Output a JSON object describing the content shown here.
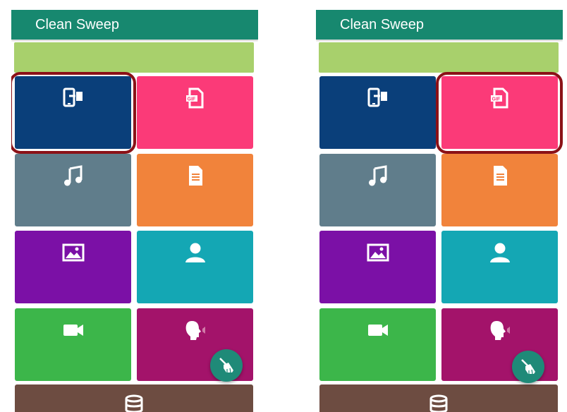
{
  "app": {
    "title": "Clean Sweep"
  },
  "screens": [
    {
      "id": "left",
      "highlighted_tile": "phone-transfer"
    },
    {
      "id": "right",
      "highlighted_tile": "gif"
    }
  ],
  "tiles": [
    {
      "key": "phone-transfer",
      "icon": "phone-transfer-icon",
      "color": "#0a3f7a"
    },
    {
      "key": "gif",
      "icon": "gif-file-icon",
      "color": "#fb3a78"
    },
    {
      "key": "music",
      "icon": "music-note-icon",
      "color": "#607d8b"
    },
    {
      "key": "document",
      "icon": "document-icon",
      "color": "#f1833b"
    },
    {
      "key": "image",
      "icon": "image-icon",
      "color": "#7b10a6"
    },
    {
      "key": "contacts",
      "icon": "person-icon",
      "color": "#14a7b4"
    },
    {
      "key": "video",
      "icon": "video-camera-icon",
      "color": "#3cb64a"
    },
    {
      "key": "voice",
      "icon": "voice-speaking-icon",
      "color": "#a3136a"
    },
    {
      "key": "storage",
      "icon": "database-icon",
      "color": "#6d4c41"
    }
  ],
  "colors": {
    "header": "#17886f",
    "banner": "#a8d06c",
    "fab": "#1f8a78",
    "highlight": "#8b1117"
  }
}
